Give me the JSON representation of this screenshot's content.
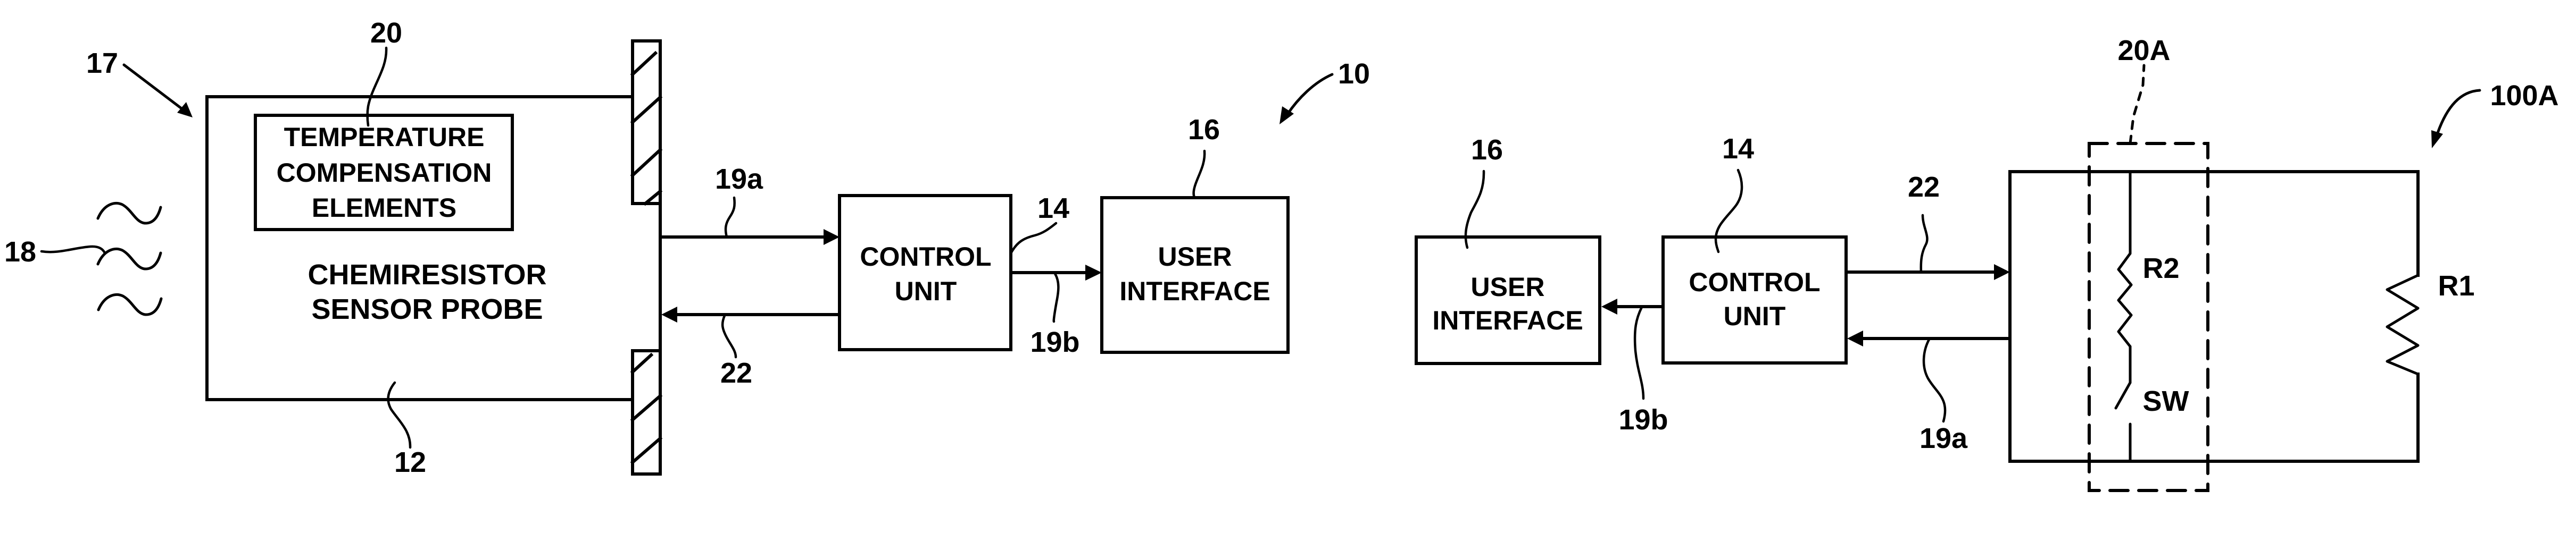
{
  "figure_left": {
    "system_ref": "10",
    "probe": {
      "ref": "12",
      "title_line1": "CHEMIRESISTOR",
      "title_line2": "SENSOR PROBE"
    },
    "temperature_block": {
      "ref": "20",
      "line1": "TEMPERATURE",
      "line2": "COMPENSATION",
      "line3": "ELEMENTS"
    },
    "probe_tip_ref": "17",
    "analyte_ref": "18",
    "control_unit": {
      "ref": "14",
      "line1": "CONTROL",
      "line2": "UNIT"
    },
    "user_interface": {
      "ref": "16",
      "line1": "USER",
      "line2": "INTERFACE"
    },
    "signals": {
      "to_control": "19a",
      "to_probe": "22",
      "to_ui": "19b"
    }
  },
  "figure_right": {
    "system_ref": "100A",
    "user_interface": {
      "ref": "16",
      "line1": "USER",
      "line2": "INTERFACE"
    },
    "control_unit": {
      "ref": "14",
      "line1": "CONTROL",
      "line2": "UNIT"
    },
    "signals": {
      "to_circuit": "22",
      "to_control": "19a",
      "to_ui": "19b"
    },
    "compensation_block_ref": "20A",
    "components": {
      "resistor_2": "R2",
      "switch": "SW",
      "resistor_1": "R1"
    }
  }
}
